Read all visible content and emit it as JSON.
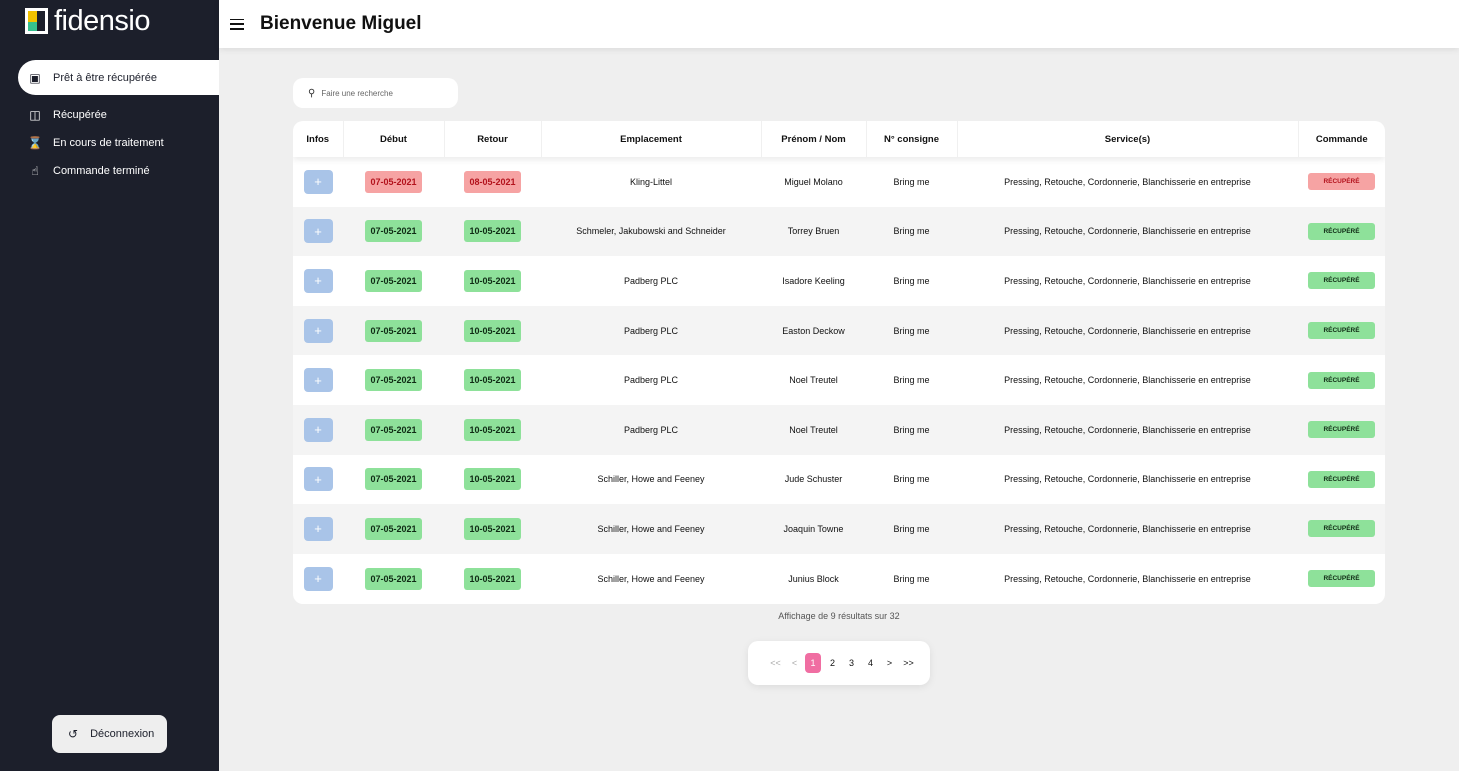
{
  "brand": {
    "name": "fidensio"
  },
  "sidebar": {
    "items": [
      {
        "label": "Prêt à être récupérée",
        "icon": "box-icon"
      },
      {
        "label": "Récupérée",
        "icon": "truck-icon"
      },
      {
        "label": "En cours de traitement",
        "icon": "hourglass-icon"
      },
      {
        "label": "Commande terminé",
        "icon": "thumbs-up-icon"
      }
    ],
    "logout": "Déconnexion"
  },
  "header": {
    "title": "Bienvenue Miguel"
  },
  "search": {
    "placeholder": "Faire une recherche"
  },
  "table": {
    "columns": [
      "Infos",
      "Début",
      "Retour",
      "Emplacement",
      "Prénom / Nom",
      "N° consigne",
      "Service(s)",
      "Commande"
    ],
    "rows": [
      {
        "debut": "07-05-2021",
        "retour": "08-05-2021",
        "emplacement": "Kling-Littel",
        "nom": "Miguel Molano",
        "consigne": "Bring me",
        "services": "Pressing, Retouche, Cordonnerie, Blanchisserie en entreprise",
        "commande": "RÉCUPÉRÉ",
        "late": true
      },
      {
        "debut": "07-05-2021",
        "retour": "10-05-2021",
        "emplacement": "Schmeler, Jakubowski and Schneider",
        "nom": "Torrey Bruen",
        "consigne": "Bring me",
        "services": "Pressing, Retouche, Cordonnerie, Blanchisserie en entreprise",
        "commande": "RÉCUPÉRÉ",
        "late": false
      },
      {
        "debut": "07-05-2021",
        "retour": "10-05-2021",
        "emplacement": "Padberg PLC",
        "nom": "Isadore Keeling",
        "consigne": "Bring me",
        "services": "Pressing, Retouche, Cordonnerie, Blanchisserie en entreprise",
        "commande": "RÉCUPÉRÉ",
        "late": false
      },
      {
        "debut": "07-05-2021",
        "retour": "10-05-2021",
        "emplacement": "Padberg PLC",
        "nom": "Easton Deckow",
        "consigne": "Bring me",
        "services": "Pressing, Retouche, Cordonnerie, Blanchisserie en entreprise",
        "commande": "RÉCUPÉRÉ",
        "late": false
      },
      {
        "debut": "07-05-2021",
        "retour": "10-05-2021",
        "emplacement": "Padberg PLC",
        "nom": "Noel Treutel",
        "consigne": "Bring me",
        "services": "Pressing, Retouche, Cordonnerie, Blanchisserie en entreprise",
        "commande": "RÉCUPÉRÉ",
        "late": false
      },
      {
        "debut": "07-05-2021",
        "retour": "10-05-2021",
        "emplacement": "Padberg PLC",
        "nom": "Noel Treutel",
        "consigne": "Bring me",
        "services": "Pressing, Retouche, Cordonnerie, Blanchisserie en entreprise",
        "commande": "RÉCUPÉRÉ",
        "late": false
      },
      {
        "debut": "07-05-2021",
        "retour": "10-05-2021",
        "emplacement": "Schiller, Howe and Feeney",
        "nom": "Jude Schuster",
        "consigne": "Bring me",
        "services": "Pressing, Retouche, Cordonnerie, Blanchisserie en entreprise",
        "commande": "RÉCUPÉRÉ",
        "late": false
      },
      {
        "debut": "07-05-2021",
        "retour": "10-05-2021",
        "emplacement": "Schiller, Howe and Feeney",
        "nom": "Joaquin Towne",
        "consigne": "Bring me",
        "services": "Pressing, Retouche, Cordonnerie, Blanchisserie en entreprise",
        "commande": "RÉCUPÉRÉ",
        "late": false
      },
      {
        "debut": "07-05-2021",
        "retour": "10-05-2021",
        "emplacement": "Schiller, Howe and Feeney",
        "nom": "Junius Block",
        "consigne": "Bring me",
        "services": "Pressing, Retouche, Cordonnerie, Blanchisserie en entreprise",
        "commande": "RÉCUPÉRÉ",
        "late": false
      }
    ],
    "plus_label": "+"
  },
  "results_text": "Affichage de 9 résultats sur 32",
  "pagination": {
    "first": "<<",
    "prev": "<",
    "pages": [
      "1",
      "2",
      "3",
      "4"
    ],
    "next": ">",
    "last": ">>",
    "current": "1"
  },
  "colors": {
    "sidebar": "#1c1f2b",
    "ok": "#8ee19a",
    "late": "#f6a3a3",
    "page_active": "#f06ea2",
    "info_button": "#a9c4e8"
  }
}
